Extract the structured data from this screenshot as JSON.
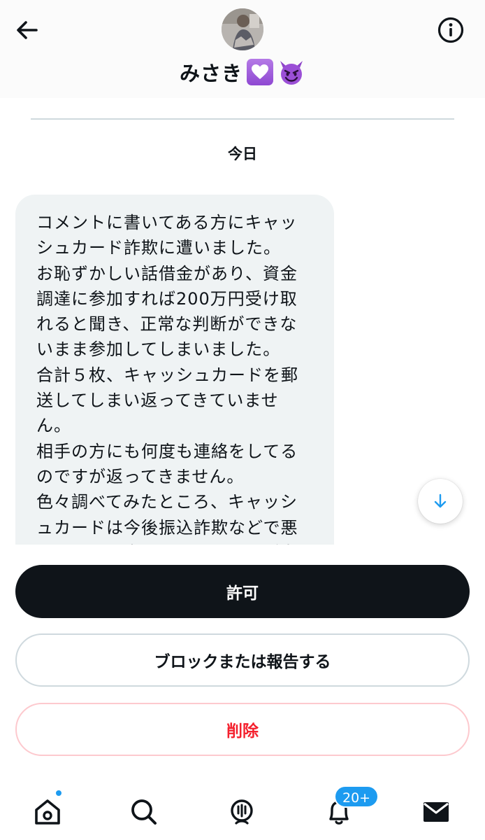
{
  "header": {
    "name": "みさき",
    "name_emojis": [
      "purple-heart-emoji",
      "smiling-devil-emoji"
    ]
  },
  "conversation": {
    "date_label": "今日",
    "messages": [
      {
        "direction": "incoming",
        "text": "コメントに書いてある方にキャッ\nシュカード詐欺に遭いました。\nお恥ずかしい話借金があり、資金\n調達に参加すれば200万円受け取\nれると聞き、正常な判断ができな\nいまま参加してしまいました。\n合計５枚、キャッシュカードを郵\n送してしまい返ってきていませ\nん。\n相手の方にも何度も連絡をしてる\nのですが返ってきません。\n色々調べてみたところ、キャッシ\nュカードは今後振込詐欺などで悪\n用されると書いてあるのですが本"
      }
    ]
  },
  "request_actions": {
    "allow_label": "許可",
    "block_report_label": "ブロックまたは報告する",
    "delete_label": "削除"
  },
  "tabbar": {
    "items": [
      {
        "icon": "home-icon",
        "has_dot": true
      },
      {
        "icon": "search-icon"
      },
      {
        "icon": "grok-icon"
      },
      {
        "icon": "bell-icon",
        "badge": "20+"
      },
      {
        "icon": "envelope-icon",
        "active": true
      }
    ],
    "notifications_badge": "20+"
  },
  "colors": {
    "primary_text": "#0f1419",
    "accent": "#1d9bf0",
    "danger": "#f4212e",
    "bubble": "#eff3f4"
  }
}
